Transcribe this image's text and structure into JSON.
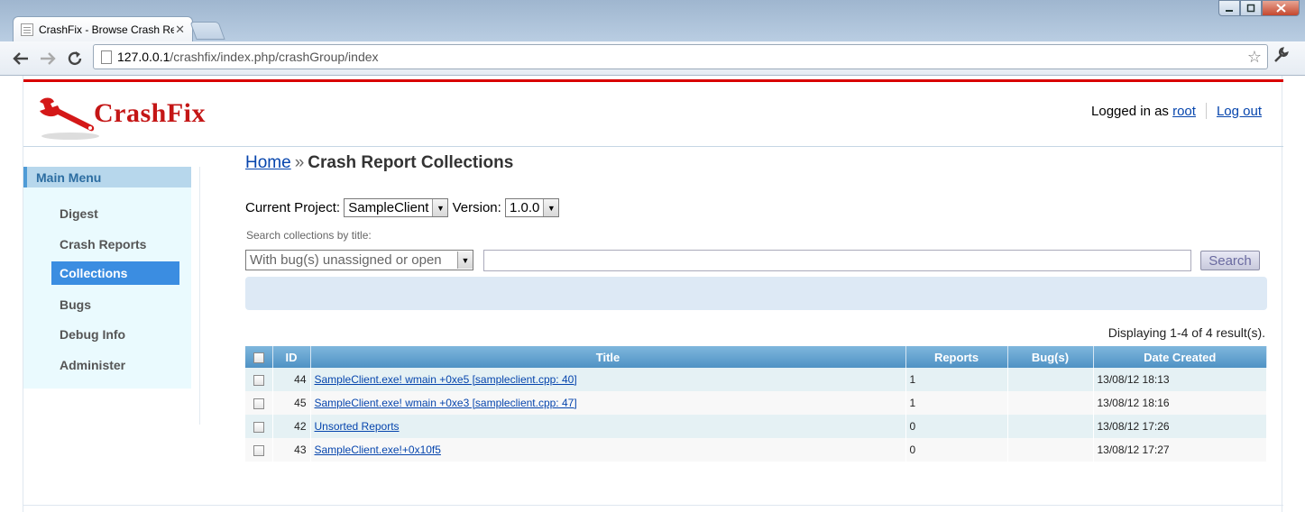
{
  "browser": {
    "tab_title": "CrashFix - Browse Crash Re",
    "tab_close": "✕",
    "url_host": "127.0.0.1",
    "url_path": "/crashfix/index.php/crashGroup/index"
  },
  "header": {
    "brand": "CrashFix",
    "logged_in_prefix": "Logged in as",
    "username": "root",
    "logout": "Log out"
  },
  "sidebar": {
    "title": "Main Menu",
    "items": [
      {
        "label": "Digest"
      },
      {
        "label": "Crash Reports"
      },
      {
        "label": "Collections"
      },
      {
        "label": "Bugs"
      },
      {
        "label": "Debug Info"
      },
      {
        "label": "Administer"
      }
    ],
    "active_item": "Collections"
  },
  "breadcrumb": {
    "home": "Home",
    "separator": "»",
    "current": "Crash Report Collections"
  },
  "filters": {
    "project_label": "Current Project:",
    "project_value": "SampleClient",
    "version_label": "Version:",
    "version_value": "1.0.0",
    "search_hint": "Search collections by title:",
    "status_value": "With bug(s) unassigned or open",
    "search_value": "",
    "search_button": "Search"
  },
  "summary": "Displaying 1-4 of 4 result(s).",
  "table": {
    "columns": [
      "ID",
      "Title",
      "Reports",
      "Bug(s)",
      "Date Created"
    ],
    "rows": [
      {
        "id": "44",
        "title": "SampleClient.exe! wmain +0xe5 [sampleclient.cpp: 40]",
        "reports": "1",
        "bugs": "",
        "date": "13/08/12 18:13"
      },
      {
        "id": "45",
        "title": "SampleClient.exe! wmain +0xe3 [sampleclient.cpp: 47]",
        "reports": "1",
        "bugs": "",
        "date": "13/08/12 18:16"
      },
      {
        "id": "42",
        "title": "Unsorted Reports",
        "reports": "0",
        "bugs": "",
        "date": "13/08/12 17:26"
      },
      {
        "id": "43",
        "title": "SampleClient.exe!+0x10f5",
        "reports": "0",
        "bugs": "",
        "date": "13/08/12 17:27"
      }
    ]
  },
  "colors": {
    "brand_red": "#c41616",
    "accent_blue": "#3b8de1",
    "header_blue": "#4f92c4"
  }
}
